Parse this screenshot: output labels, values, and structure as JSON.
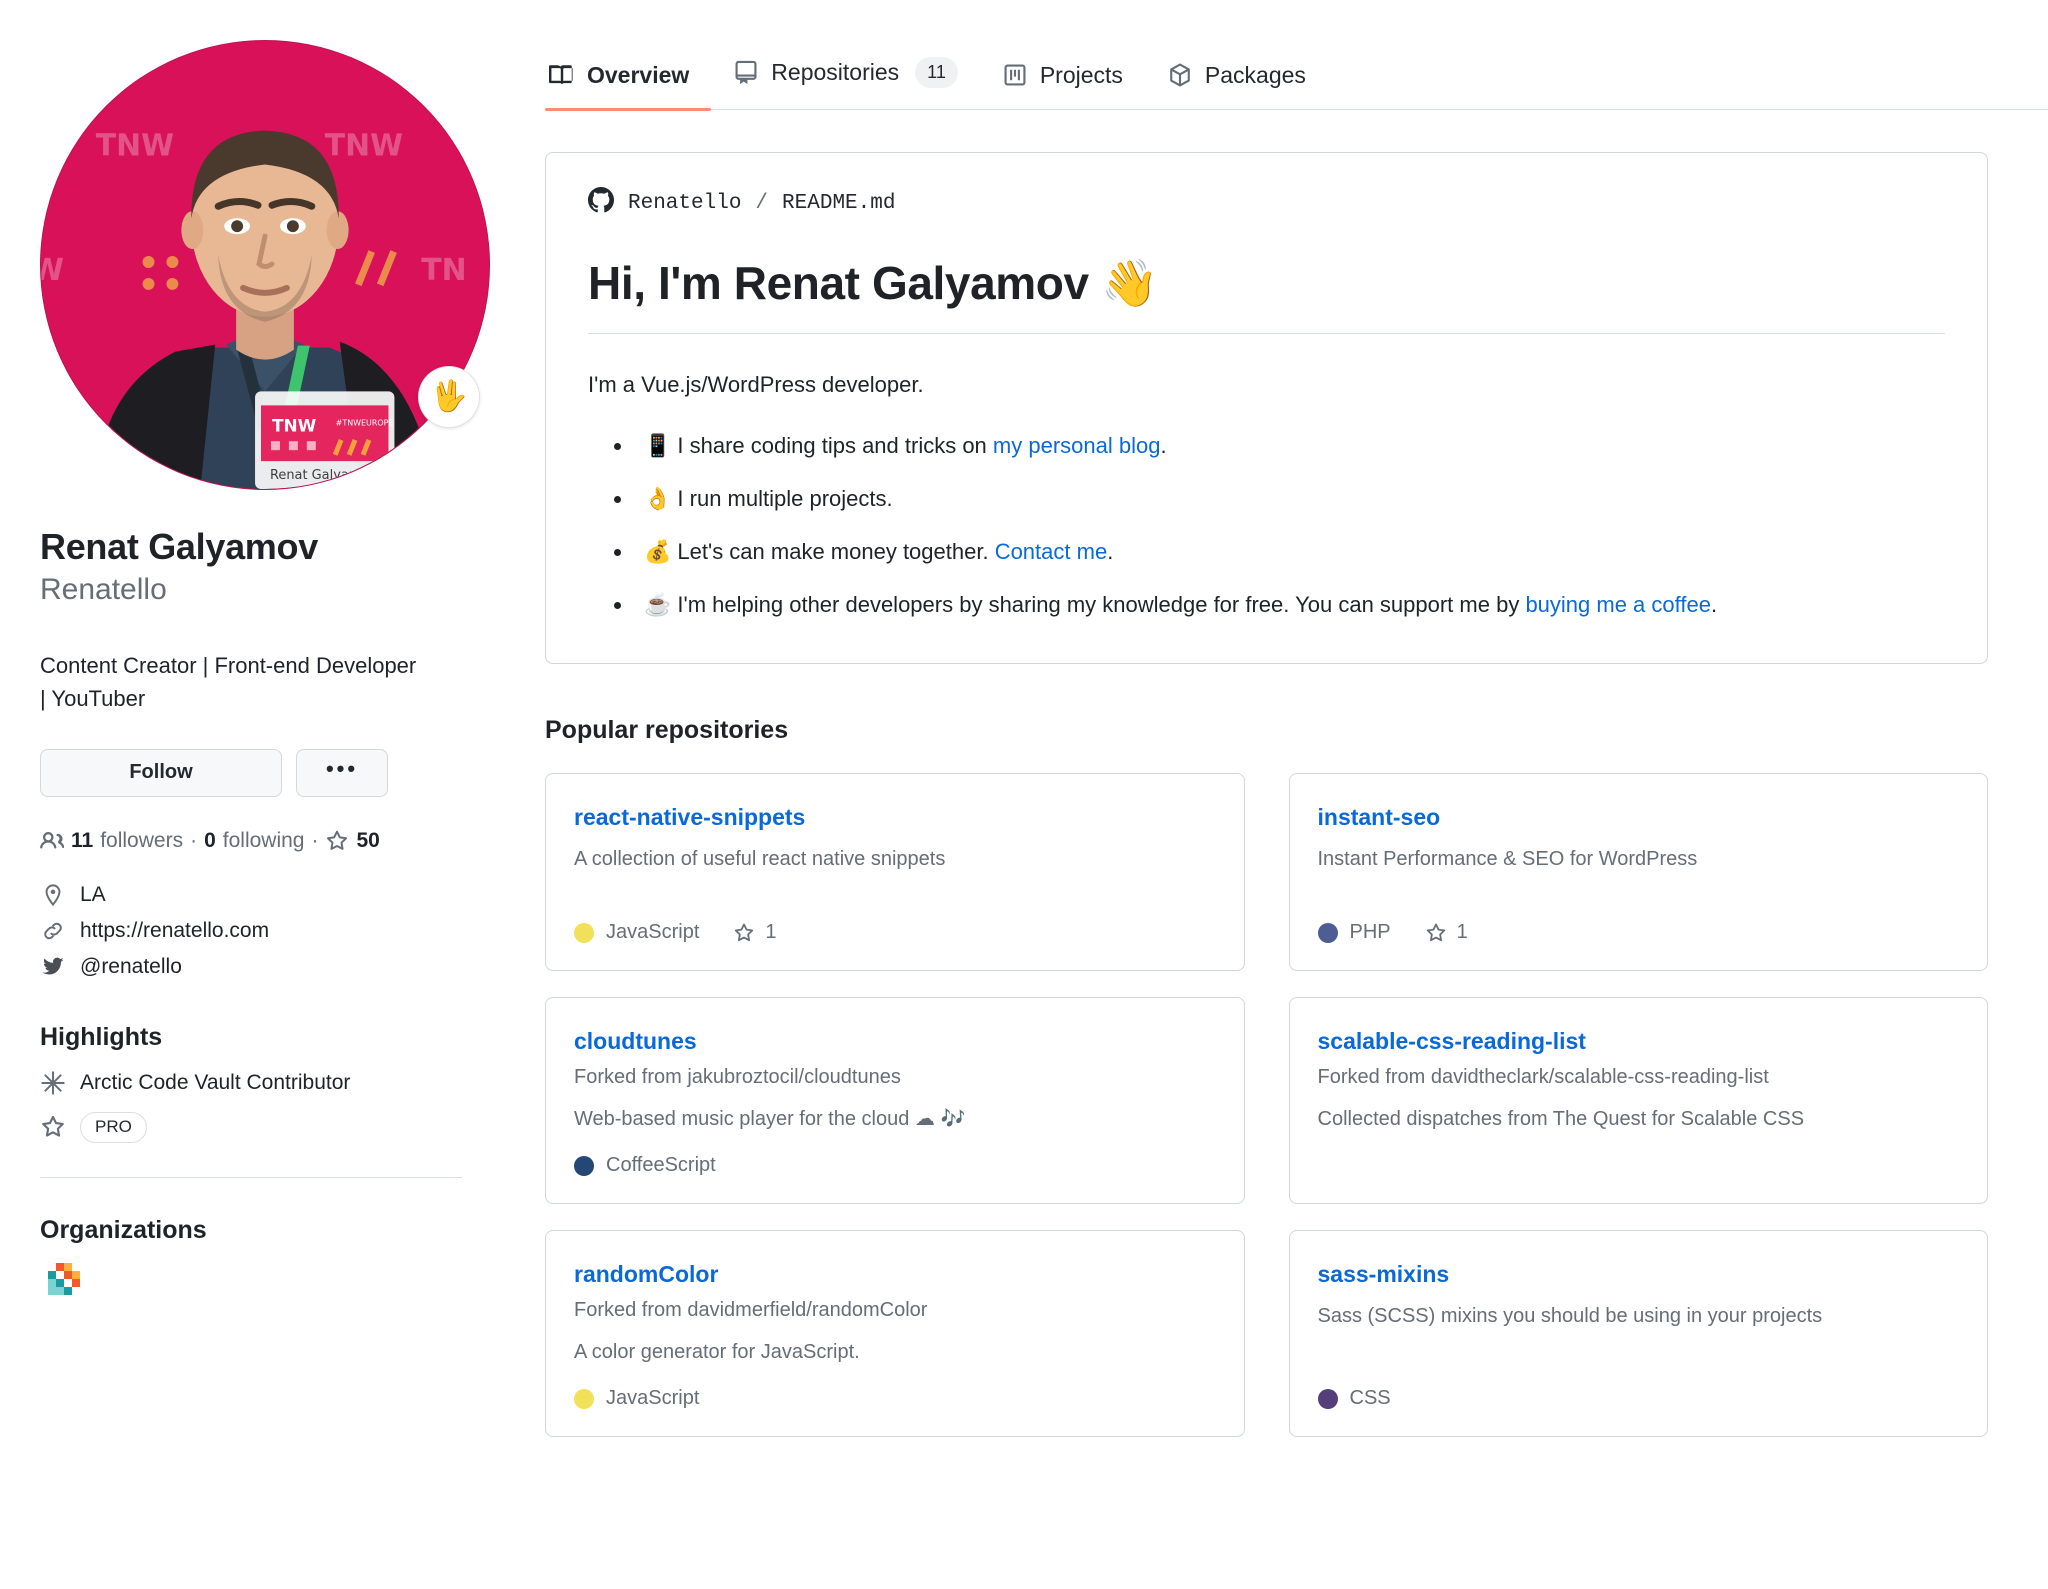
{
  "tabs": [
    {
      "label": "Overview",
      "icon": "book-icon",
      "active": true,
      "count": null
    },
    {
      "label": "Repositories",
      "icon": "repo-icon",
      "active": false,
      "count": "11"
    },
    {
      "label": "Projects",
      "icon": "project-icon",
      "active": false,
      "count": null
    },
    {
      "label": "Packages",
      "icon": "package-icon",
      "active": false,
      "count": null
    }
  ],
  "profile": {
    "full_name": "Renat Galyamov",
    "username": "Renatello",
    "bio": "Content Creator | Front-end Developer | YouTuber",
    "avatar_badge_emoji": "🖖",
    "follow_label": "Follow",
    "more_label": "•••",
    "stats": {
      "followers_count": "11",
      "followers_label": "followers",
      "separator": "·",
      "following_count": "0",
      "following_label": "following",
      "stars_count": "50"
    },
    "meta": [
      {
        "icon": "location-icon",
        "text": "LA"
      },
      {
        "icon": "link-icon",
        "text": "https://renatello.com"
      },
      {
        "icon": "twitter-icon",
        "text": "@renatello"
      }
    ]
  },
  "highlights": {
    "title": "Highlights",
    "items": [
      {
        "icon": "arctic-vault-icon",
        "text": "Arctic Code Vault Contributor",
        "badge": null
      },
      {
        "icon": "star-icon",
        "text": "",
        "badge": "PRO"
      }
    ]
  },
  "organizations": {
    "title": "Organizations",
    "logos": [
      {
        "name": "org-logo-mosaic"
      }
    ]
  },
  "readme": {
    "owner": "Renatello",
    "slash": "/",
    "file": "README.md",
    "heading": "Hi, I'm Renat Galyamov 👋",
    "intro": "I'm a Vue.js/WordPress developer.",
    "bullets": [
      {
        "emoji": "📱",
        "before": "I share coding tips and tricks on ",
        "link": "my personal blog",
        "after": "."
      },
      {
        "emoji": "👌",
        "before": "I run multiple projects.",
        "link": "",
        "after": ""
      },
      {
        "emoji": "💰",
        "before": "Let's can make money together. ",
        "link": "Contact me",
        "after": "."
      },
      {
        "emoji": "☕",
        "before": "I'm helping other developers by sharing my knowledge for free. You can support me by ",
        "link": "buying me a coffee",
        "after": "."
      }
    ]
  },
  "popular": {
    "title": "Popular repositories",
    "repos": [
      {
        "name": "react-native-snippets",
        "forked_from": "",
        "description": "A collection of useful react native snippets",
        "language": "JavaScript",
        "language_color": "#f1e05a",
        "stars": "1"
      },
      {
        "name": "instant-seo",
        "forked_from": "",
        "description": "Instant Performance & SEO for WordPress",
        "language": "PHP",
        "language_color": "#4F5D95",
        "stars": "1"
      },
      {
        "name": "cloudtunes",
        "forked_from": "Forked from jakubroztocil/cloudtunes",
        "description": "Web-based music player for the cloud ☁ 🎶",
        "language": "CoffeeScript",
        "language_color": "#244776",
        "stars": ""
      },
      {
        "name": "scalable-css-reading-list",
        "forked_from": "Forked from davidtheclark/scalable-css-reading-list",
        "description": "Collected dispatches from The Quest for Scalable CSS",
        "language": "",
        "language_color": "",
        "stars": ""
      },
      {
        "name": "randomColor",
        "forked_from": "Forked from davidmerfield/randomColor",
        "description": "A color generator for JavaScript.",
        "language": "JavaScript",
        "language_color": "#f1e05a",
        "stars": ""
      },
      {
        "name": "sass-mixins",
        "forked_from": "",
        "description": "Sass (SCSS) mixins you should be using in your projects",
        "language": "CSS",
        "language_color": "#563d7c",
        "stars": ""
      }
    ]
  },
  "colors": {
    "accent_underline": "#fd8c73",
    "link": "#0969da",
    "border": "#d0d7de",
    "muted_text": "#656d76"
  }
}
